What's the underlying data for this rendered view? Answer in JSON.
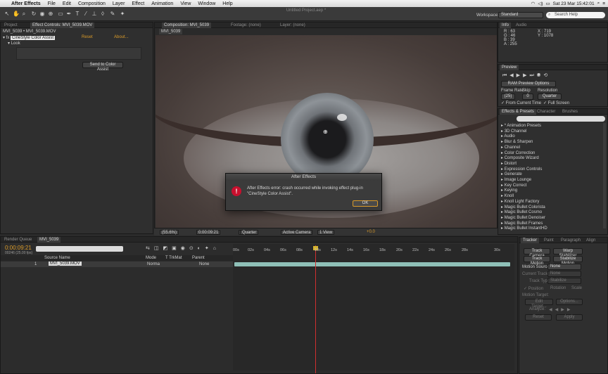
{
  "menubar": {
    "app": "After Effects",
    "items": [
      "File",
      "Edit",
      "Composition",
      "Layer",
      "Effect",
      "Animation",
      "View",
      "Window",
      "Help"
    ],
    "datetime": "Sat 23 Mar  15:42:01"
  },
  "document_title": "Untitled Project.aep *",
  "workspace": {
    "label": "Workspace:",
    "value": "Standard"
  },
  "search": {
    "placeholder": "Search Help"
  },
  "project_panel": {
    "tabs": [
      "Project",
      "Effect Controls: MVI_5039.MOV"
    ],
    "path": "MVI_5039 • MVI_5039.MOV",
    "effect_name": "CineStyle Color Assist",
    "reset": "Reset",
    "about": "About...",
    "look": "Look",
    "button": "Send to Color Assist"
  },
  "comp_panel": {
    "tabs": [
      "Composition: MVI_5039",
      "Footage: (none)",
      "Layer: (none)"
    ],
    "subtab": "MVI_5039",
    "bottom": {
      "zoom": "(55.6%)",
      "timecode": "0:00:09:21",
      "resolution": "Quarter",
      "camera": "Active Camera",
      "view": "1 View",
      "exposure": "+0.0"
    }
  },
  "dialog": {
    "title": "After Effects",
    "message": "After Effects error: crash occurred while invoking effect plug-in \"CineStyle Color Assist\".",
    "ok": "OK"
  },
  "info_panel": {
    "tabs": [
      "Info",
      "Audio"
    ],
    "r": "R : 63",
    "g": "G : 46",
    "b": "B : 39",
    "a": "A : 255",
    "x": "X : 719",
    "y": "Y : 1078"
  },
  "preview_panel": {
    "tab": "Preview",
    "ram_options": "RAM Preview Options",
    "frame_rate_label": "Frame Rate",
    "skip_label": "Skip",
    "resolution_label": "Resolution",
    "frame_rate": "(25)",
    "skip": "0",
    "resolution": "Quarter",
    "from_current": "From Current Time",
    "full_screen": "Full Screen"
  },
  "effects_panel": {
    "tabs": [
      "Effects & Presets",
      "Character",
      "Brushes"
    ],
    "items": [
      "* Animation Presets",
      "3D Channel",
      "Audio",
      "Blur & Sharpen",
      "Channel",
      "Color Correction",
      "Composite Wizard",
      "Distort",
      "Expression Controls",
      "Generate",
      "Image Lounge",
      "Key Correct",
      "Keying",
      "Knoll",
      "Knoll Light Factory",
      "Magic Bullet Colorista",
      "Magic Bullet Cosmo",
      "Magic Bullet Denoiser",
      "Magic Bullet Frames",
      "Magic Bullet InstantHD"
    ]
  },
  "timeline": {
    "tabs": [
      "Render Queue",
      "MVI_5039"
    ],
    "timecode": "0:00:09:21",
    "frame": "00246 (25.00 fps)",
    "columns": [
      "Source Name",
      "Mode",
      "T TrkMat",
      "Parent"
    ],
    "layer": {
      "number": "1",
      "name": "MVI_5039.MOV",
      "mode": "Norma",
      "parent": "None"
    },
    "ruler": [
      "00s",
      "02s",
      "04s",
      "06s",
      "08s",
      "10s",
      "12s",
      "14s",
      "16s",
      "18s",
      "20s",
      "22s",
      "24s",
      "26s",
      "28s",
      "30s"
    ]
  },
  "tracker_panel": {
    "tabs": [
      "Tracker",
      "Paint",
      "Paragraph",
      "Align"
    ],
    "track_camera": "Track Camera",
    "warp_stabilizer": "Warp Stabilizer",
    "track_motion": "Track Motion",
    "stabilize_motion": "Stabilize Motion",
    "motion_source_label": "Motion Source:",
    "motion_source": "None",
    "current_track_label": "Current Track:",
    "current_track": "None",
    "track_type_label": "Track Type:",
    "track_type": "Stabilize",
    "position": "Position",
    "rotation": "Rotation",
    "scale": "Scale",
    "motion_target": "Motion Target:",
    "edit_target": "Edit Target...",
    "options": "Options...",
    "analyze": "Analyze:",
    "reset": "Reset",
    "apply": "Apply"
  },
  "colors": {
    "accent": "#d99a29",
    "error": "#c8102e",
    "playhead": "#d03030",
    "layer_bar": "#8fc0b8"
  }
}
